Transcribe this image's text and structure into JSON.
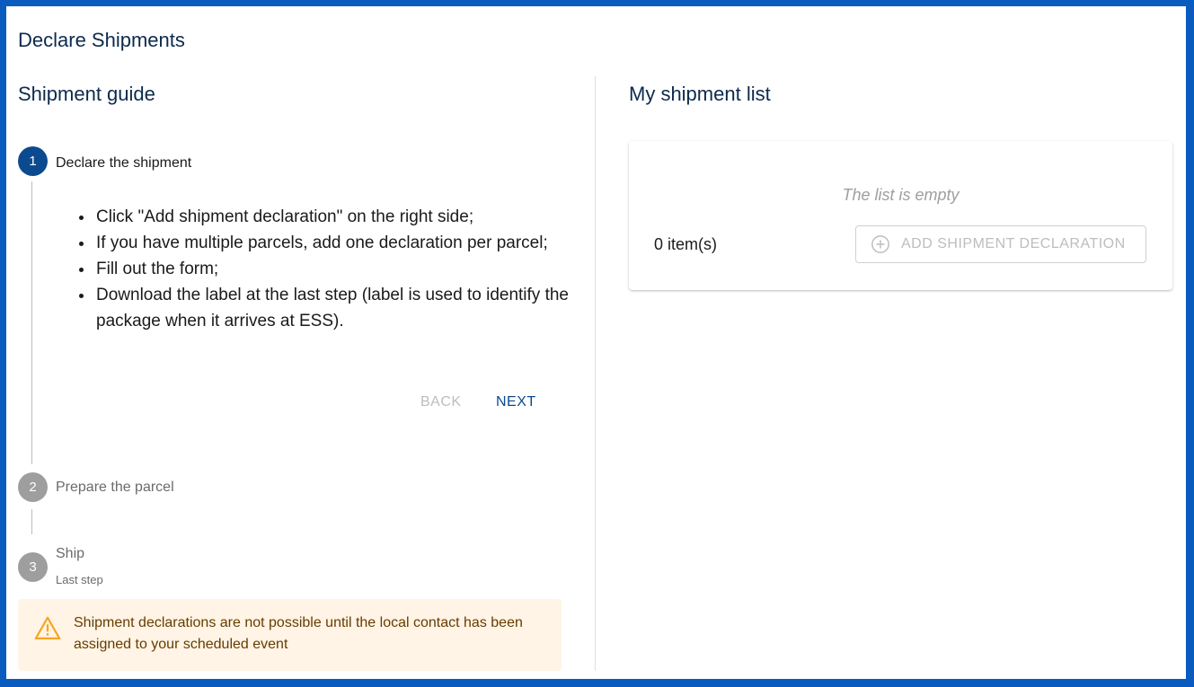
{
  "page": {
    "title": "Declare Shipments"
  },
  "guide": {
    "title": "Shipment guide",
    "steps": [
      {
        "number": "1",
        "label": "Declare the shipment",
        "state": "active"
      },
      {
        "number": "2",
        "label": "Prepare the parcel",
        "state": "inactive"
      },
      {
        "number": "3",
        "label": "Ship",
        "sublabel": "Last step",
        "state": "inactive"
      }
    ],
    "instructions": [
      "Click \"Add shipment declaration\" on the right side;",
      "If you have multiple parcels, add one declaration per parcel;",
      "Fill out the form;",
      "Download the label at the last step (label is used to identify the package when it arrives at ESS)."
    ],
    "back_label": "BACK",
    "next_label": "NEXT"
  },
  "warning": {
    "text": "Shipment declarations are not possible until the local contact has been assigned to your scheduled event",
    "icon": "warning-triangle-icon"
  },
  "list": {
    "title": "My shipment list",
    "empty_text": "The list is empty",
    "count_text": "0 item(s)",
    "add_button_label": "ADD SHIPMENT DECLARATION",
    "add_button_icon": "plus-circle-icon"
  },
  "colors": {
    "frame": "#0a5bbf",
    "primary": "#0c4a8f",
    "inactive_step": "#9e9e9e",
    "warning_bg": "#fff4e5",
    "warning_icon": "#f5a623"
  }
}
